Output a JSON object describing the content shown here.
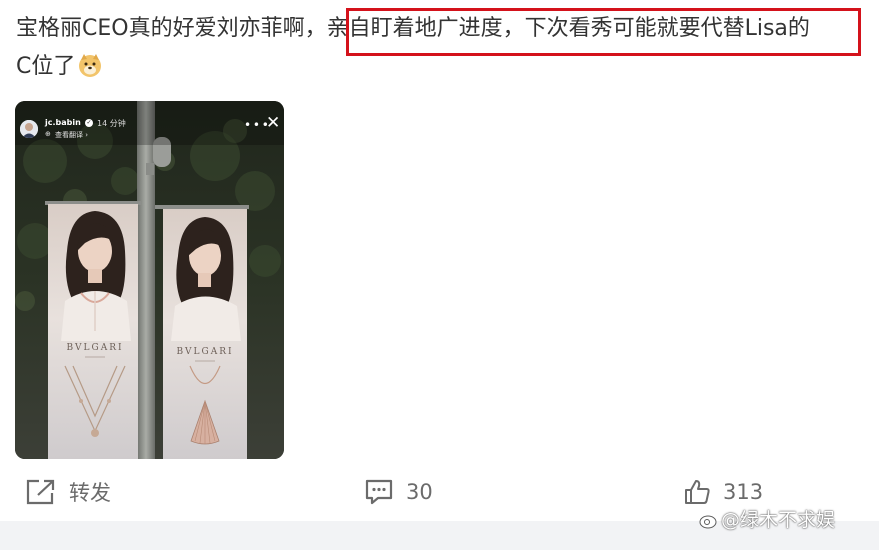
{
  "post": {
    "text_before": "宝格丽CEO真的好爱刘亦菲啊，",
    "text_highlighted": "亲自盯着地广进度，下次看秀可能就要代替Lisa的",
    "text_after": "C位了",
    "emoji": "doge-emoji",
    "highlight_color": "#d4121b"
  },
  "story": {
    "username": "jc.babin",
    "verified_mark": "✓",
    "time_ago": "14 分钟",
    "subtitle": "查看翻译 ›",
    "more_icon": "more-dots-icon",
    "close_icon": "close-icon",
    "banners": [
      {
        "brand": "BVLGARI"
      },
      {
        "brand": "BVLGARI"
      }
    ]
  },
  "actions": {
    "repost_label": "转发",
    "comment_count": "30",
    "like_count": "313"
  },
  "watermark": {
    "text": "@绿木不求娱"
  }
}
